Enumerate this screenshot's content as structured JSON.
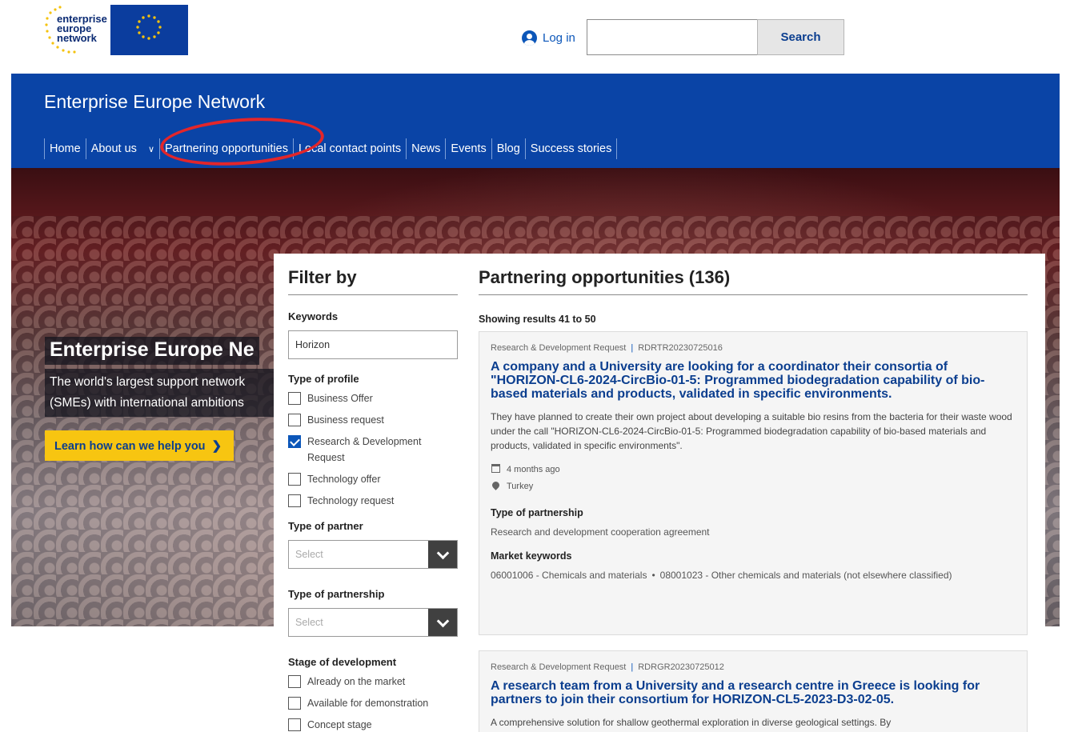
{
  "top_bar": {
    "logo_words": [
      "enterprise",
      "europe",
      "network"
    ],
    "login_label": "Log in",
    "search_value": "",
    "search_button": "Search"
  },
  "header": {
    "site_title": "Enterprise Europe Network",
    "nav": [
      {
        "label": "Home"
      },
      {
        "label": "About us"
      },
      {
        "label": "Partnering opportunities"
      },
      {
        "label": "Local contact points"
      },
      {
        "label": "News"
      },
      {
        "label": "Events"
      },
      {
        "label": "Blog"
      },
      {
        "label": "Success stories"
      }
    ]
  },
  "hero": {
    "title": "Enterprise Europe Ne",
    "subtitle": "The world's largest support network (SMEs) with international ambitions",
    "cta": "Learn how can we help you"
  },
  "filters": {
    "title": "Filter by",
    "keywords_label": "Keywords",
    "keywords_value": "Horizon",
    "type_of_profile_label": "Type of profile",
    "profile_options": [
      {
        "label": "Business Offer",
        "checked": false
      },
      {
        "label": "Business request",
        "checked": false
      },
      {
        "label": "Research & Development Request",
        "checked": true
      },
      {
        "label": "Technology offer",
        "checked": false
      },
      {
        "label": "Technology request",
        "checked": false
      }
    ],
    "type_of_partner_label": "Type of partner",
    "type_of_partner_value": "Select",
    "type_of_partnership_label": "Type of partnership",
    "type_of_partnership_value": "Select",
    "stage_label": "Stage of development",
    "stage_options": [
      {
        "label": "Already on the market",
        "checked": false
      },
      {
        "label": "Available for demonstration",
        "checked": false
      },
      {
        "label": "Concept stage",
        "checked": false
      }
    ]
  },
  "results": {
    "title": "Partnering opportunities (136)",
    "showing": "Showing results 41 to 50",
    "cards": [
      {
        "type": "Research & Development Request",
        "ref": "RDRTR20230725016",
        "title": "A company and a University are looking for a coordinator their consortia of \"HORIZON-CL6-2024-CircBio-01-5: Programmed biodegradation capability of bio-based materials and products, validated in specific environments.",
        "description": "They have planned to create their own project about developing a suitable bio resins from the bacteria for their waste wood under the call \"HORIZON-CL6-2024-CircBio-01-5: Programmed biodegradation capability of bio-based materials and products, validated in specific environments\".",
        "date": "4 months ago",
        "country": "Turkey",
        "partnership_label": "Type of partnership",
        "partnership": "Research and development cooperation agreement",
        "keywords_label": "Market keywords",
        "keyword_1": "06001006 - Chemicals and materials",
        "keyword_2": "08001023 - Other chemicals and materials (not elsewhere classified)"
      },
      {
        "type": "Research & Development Request",
        "ref": "RDRGR20230725012",
        "title": "A research team from a University and a research centre in Greece is looking for partners to join their consortium for HORIZON-CL5-2023-D3-02-05.",
        "description": "A comprehensive solution for shallow geothermal exploration in diverse geological settings. By"
      }
    ]
  },
  "colors": {
    "header_blue": "#0a44a6",
    "link_blue": "#0b3e8f",
    "cta_yellow": "#f7c511",
    "highlight_red": "#e3262a"
  }
}
